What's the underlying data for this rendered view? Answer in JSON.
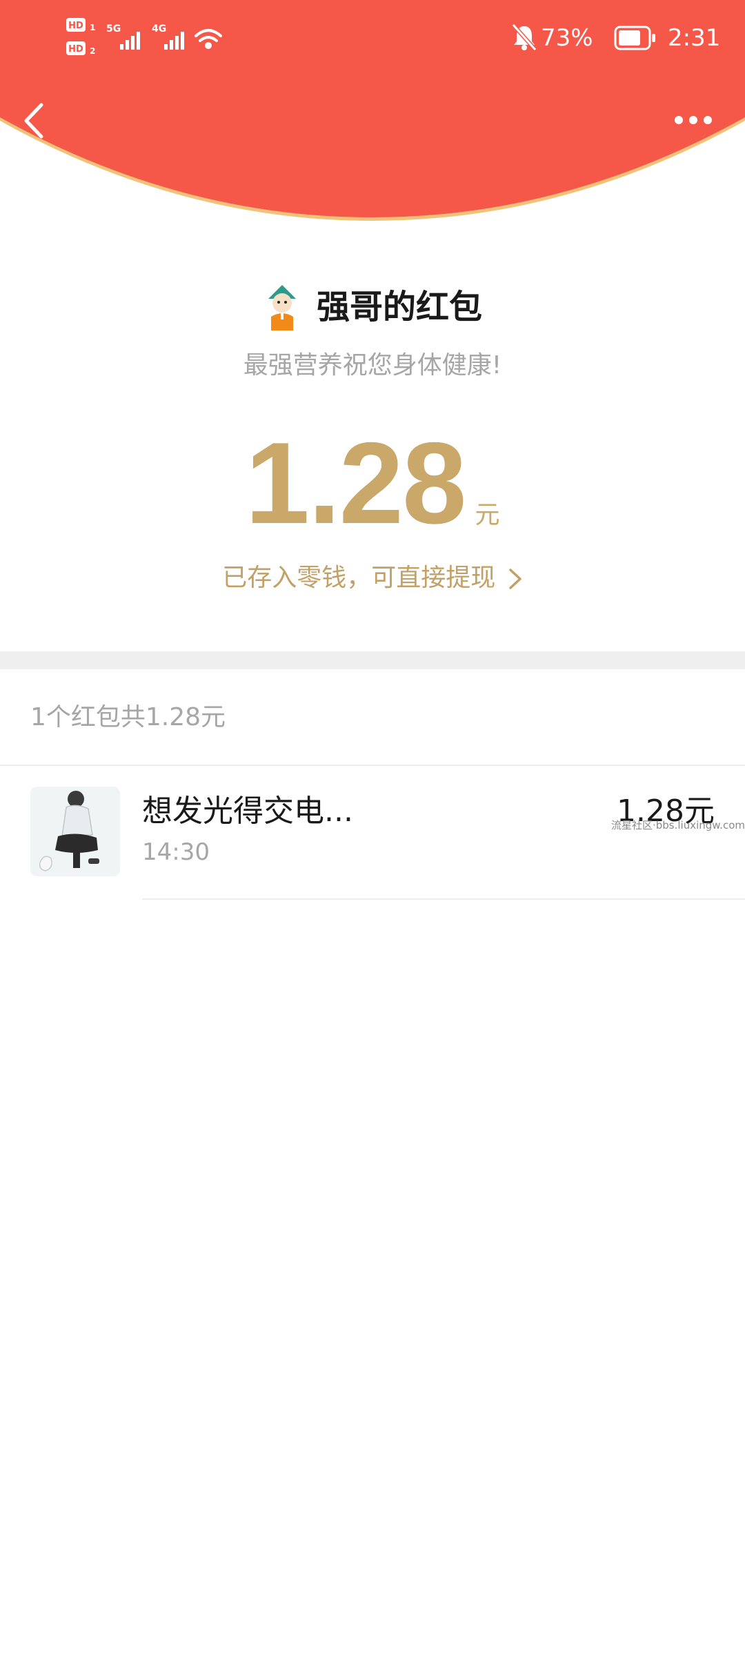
{
  "colors": {
    "header_red": "#F55749",
    "header_edge": "#F3C27A",
    "gold": "#C9A86A",
    "text_dark": "#1A1A1A",
    "text_gray": "#A6A6A6"
  },
  "status_bar": {
    "sim1_label": "HD",
    "sim1_index": "1",
    "sim2_label": "HD",
    "sim2_index": "2",
    "net1": "5G",
    "net2": "4G",
    "battery_percent": "73%",
    "time": "2:31",
    "icons": [
      "signal-icon",
      "wifi-icon",
      "bell-muted-icon",
      "battery-icon"
    ]
  },
  "nav": {
    "back_icon": "chevron-left-icon",
    "more_icon": "more-dots-icon"
  },
  "envelope": {
    "sender_name": "强哥的红包",
    "blessing": "最强营养祝您身体健康!",
    "amount": "1.28",
    "currency": "元",
    "stored_text": "已存入零钱，可直接提现"
  },
  "summary": {
    "text": "1个红包共1.28元"
  },
  "records": [
    {
      "name": "想发光得交电...",
      "time": "14:30",
      "amount": "1.28元"
    }
  ],
  "watermark": "流星社区·bbs.liuxingw.com"
}
